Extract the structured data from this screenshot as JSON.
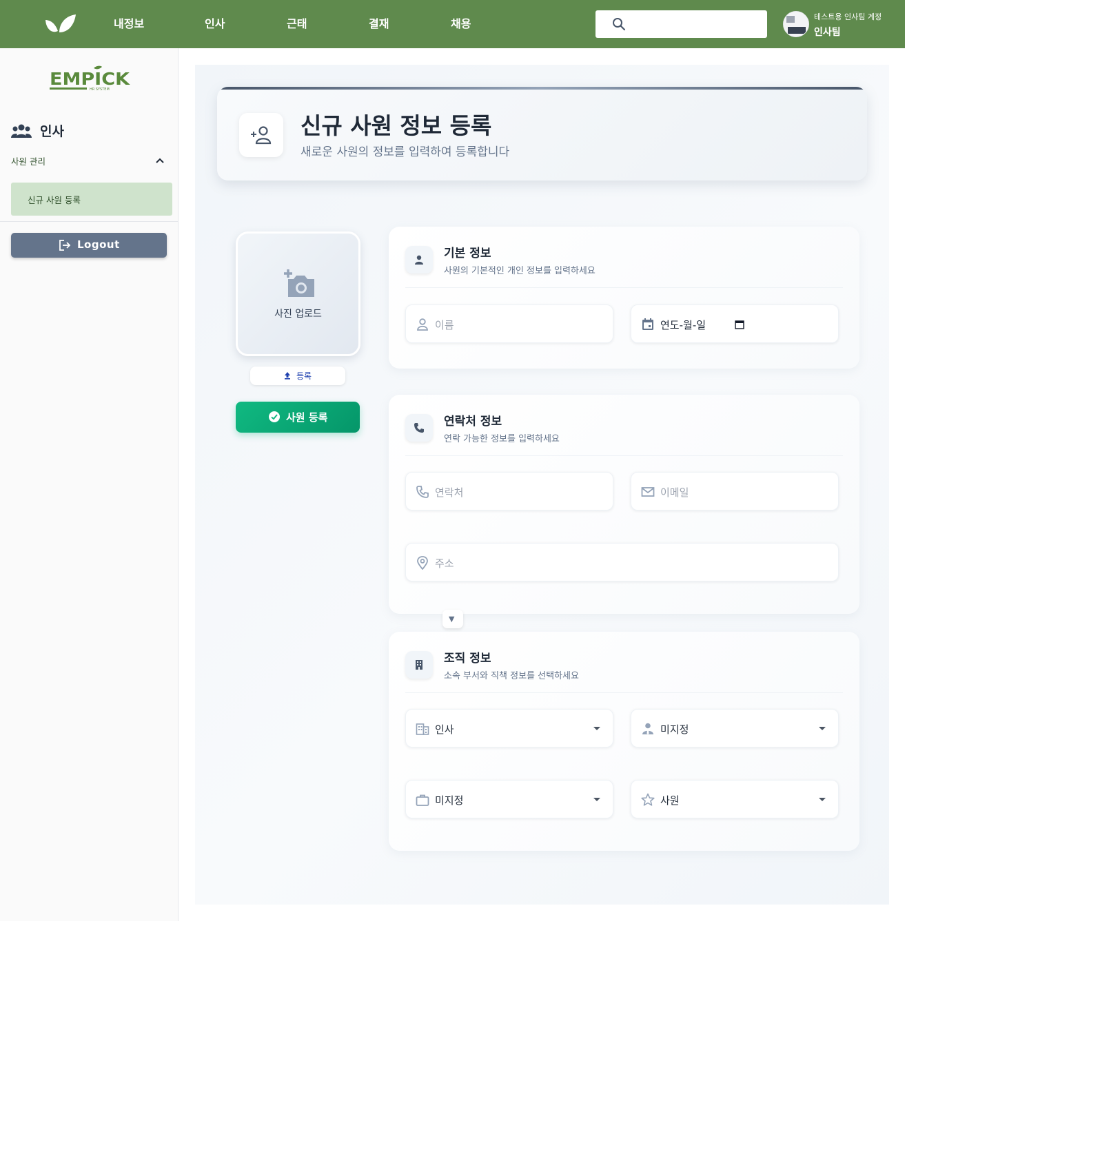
{
  "nav": {
    "items": [
      {
        "label": "내정보"
      },
      {
        "label": "인사"
      },
      {
        "label": "근태"
      },
      {
        "label": "결재"
      },
      {
        "label": "채용"
      }
    ],
    "search_placeholder": ""
  },
  "user": {
    "account": "테스트용 인사팀 계정",
    "team": "인사팀"
  },
  "brand": {
    "logo_text": "EMPICK",
    "logo_sub": "HR SYSTEM"
  },
  "sidebar": {
    "section_title": "인사",
    "submenu_label": "사원 관리",
    "active_item": "신규 사원 등록",
    "logout_label": "Logout"
  },
  "header": {
    "title": "신규 사원 정보 등록",
    "subtitle": "새로운 사원의 정보를 입력하여 등록합니다"
  },
  "photo": {
    "label": "사진 업로드",
    "upload_label": "등록",
    "submit_label": "사원 등록"
  },
  "basic": {
    "title": "기본 정보",
    "subtitle": "사원의 기본적인 개인 정보를 입력하세요",
    "name_placeholder": "이름",
    "birth_placeholder": "연도-월-일"
  },
  "contact": {
    "title": "연락처 정보",
    "subtitle": "연락 가능한 정보를 입력하세요",
    "phone_placeholder": "연락처",
    "email_placeholder": "이메일",
    "address_placeholder": "주소"
  },
  "org": {
    "title": "조직 정보",
    "subtitle": "소속 부서와 직책 정보를 선택하세요",
    "department": "인사",
    "position": "미지정",
    "job": "미지정",
    "rank": "사원"
  },
  "colors": {
    "topbar": "#5f8a4d",
    "sidebar_active": "#cfe3cc",
    "logout": "#64748b",
    "submit": "#10b981"
  }
}
